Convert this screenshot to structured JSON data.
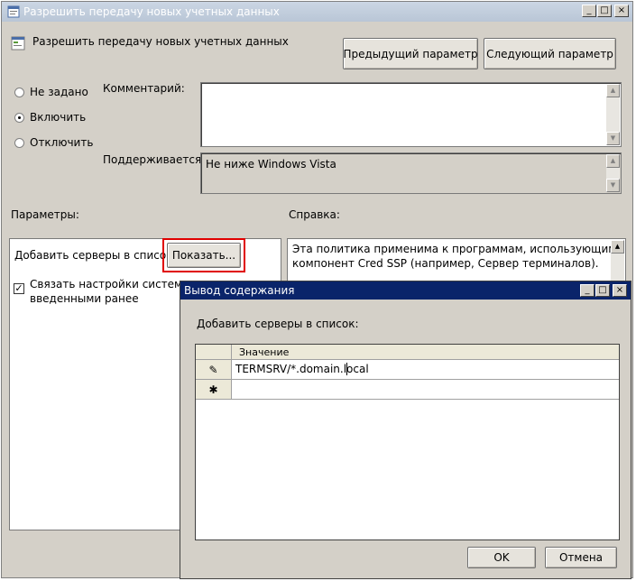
{
  "main_window": {
    "title": "Разрешить передачу новых учетных данных",
    "policy_name": "Разрешить передачу новых учетных данных",
    "prev_button": "Предыдущий параметр",
    "next_button": "Следующий параметр",
    "radios": [
      {
        "label": "Не задано",
        "selected": false
      },
      {
        "label": "Включить",
        "selected": true
      },
      {
        "label": "Отключить",
        "selected": false
      }
    ],
    "comment_label": "Комментарий:",
    "comment_value": "",
    "supported_label": "Поддерживается:",
    "supported_value": "Не ниже Windows Vista",
    "params_label": "Параметры:",
    "help_label": "Справка:",
    "add_servers_label": "Добавить серверы в список:",
    "show_button": "Показать...",
    "concat_checkbox_label_line1": "Связать настройки системы по",
    "concat_checkbox_label_line2": "введенными ранее",
    "concat_checked": true,
    "help_text_line1": "Эта политика применима к программам, использующим",
    "help_text_line2": "компонент Cred SSP (например, Сервер терминалов).",
    "highlight_color": "#e00000"
  },
  "dialog": {
    "title": "Вывод содержания",
    "list_label": "Добавить серверы в список:",
    "column_header": "Значение",
    "rows": [
      {
        "marker": "pencil-icon",
        "value": "TERMSRV/*.domain.local"
      },
      {
        "marker": "asterisk-icon",
        "value": ""
      }
    ],
    "ok_button": "OK",
    "cancel_button": "Отмена"
  },
  "icons": {
    "maximize": "□",
    "close": "×",
    "minimize": "_",
    "new_row": "✱",
    "edit_row": "✎"
  }
}
